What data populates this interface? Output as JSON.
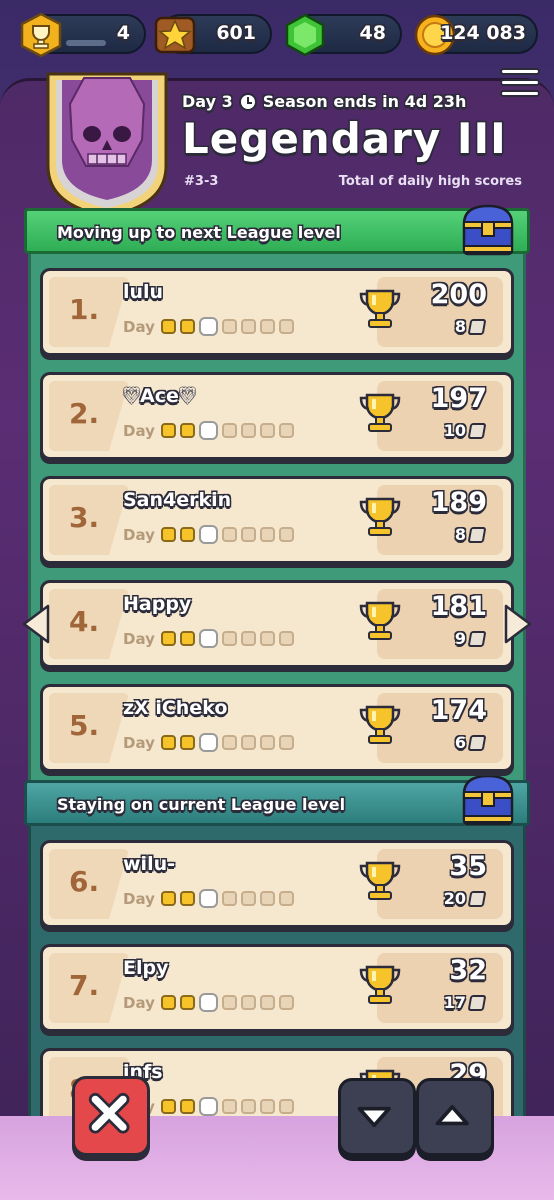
{
  "currency": {
    "trophies": "4",
    "stars": "601",
    "gems": "48",
    "gold": "124 083"
  },
  "header": {
    "day": "Day 3",
    "season": "Season ends in 4d 23h",
    "title": "Legendary III",
    "code": "#3-3",
    "subtitle": "Total of daily high scores"
  },
  "sections": {
    "promote": "Moving up to next League level",
    "stay": "Staying on current League level"
  },
  "day_label": "Day",
  "players": [
    {
      "rank": "1.",
      "name": "lulu",
      "score": "200",
      "games": "8",
      "days_done": 2
    },
    {
      "rank": "2.",
      "name": "♡Ace♡",
      "score": "197",
      "games": "10",
      "days_done": 2
    },
    {
      "rank": "3.",
      "name": "San4erkin",
      "score": "189",
      "games": "8",
      "days_done": 2
    },
    {
      "rank": "4.",
      "name": "Happy",
      "score": "181",
      "games": "9",
      "days_done": 2
    },
    {
      "rank": "5.",
      "name": "zX iCheko",
      "score": "174",
      "games": "6",
      "days_done": 2
    },
    {
      "rank": "6.",
      "name": "wilu-",
      "score": "35",
      "games": "20",
      "days_done": 2
    },
    {
      "rank": "7.",
      "name": "Elpy",
      "score": "32",
      "games": "17",
      "days_done": 2
    },
    {
      "rank": "8.",
      "name": "infs",
      "score": "29",
      "games": "",
      "days_done": 2
    }
  ],
  "colors": {
    "promote_zone": "#3e9a78",
    "stay_zone": "#2e6a6b",
    "row_bg": "#f6e7cf",
    "close_button": "#e4484a"
  }
}
